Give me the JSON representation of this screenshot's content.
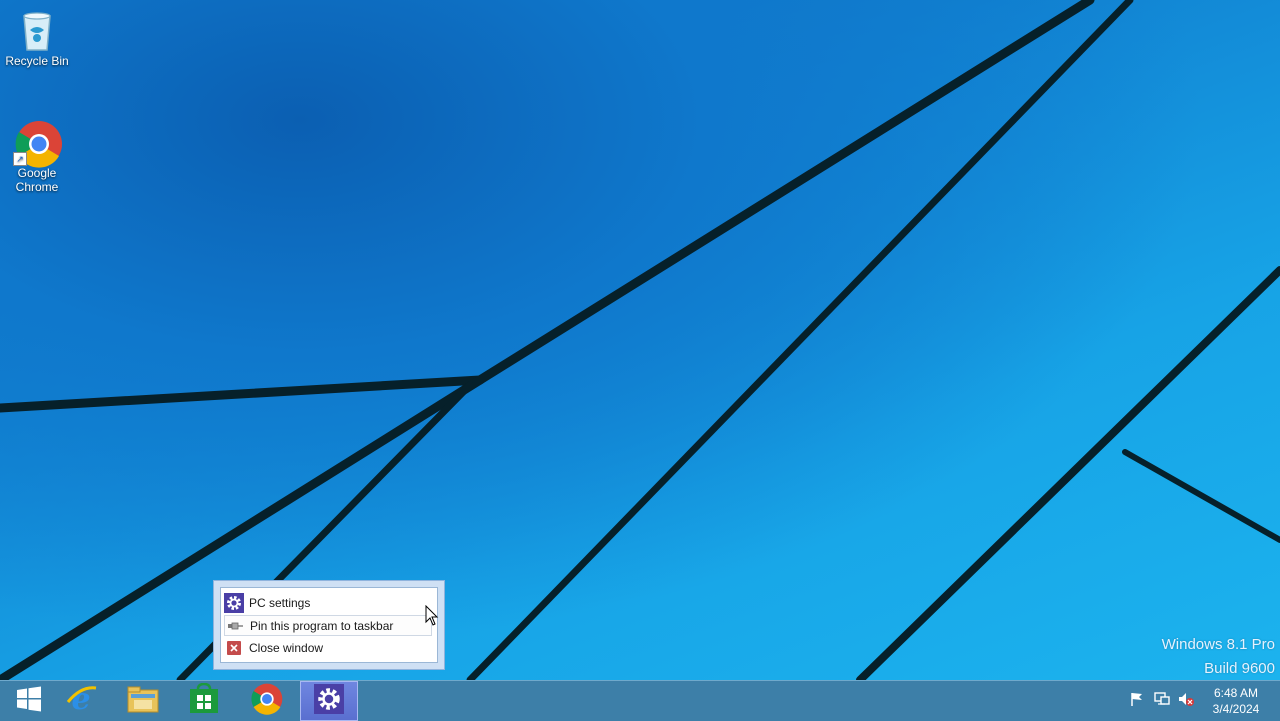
{
  "desktop": {
    "icons": [
      {
        "label": "Recycle Bin",
        "icon": "recycle-bin-icon"
      },
      {
        "label": "Google\nChrome",
        "icon": "chrome-icon"
      }
    ],
    "watermark": {
      "line1": "Windows 8.1 Pro",
      "line2": "Build 9600"
    }
  },
  "jumplist": {
    "items": [
      {
        "label": "PC settings",
        "icon": "gear-icon"
      },
      {
        "label": "Pin this program to taskbar",
        "icon": "pin-icon"
      },
      {
        "label": "Close window",
        "icon": "close-icon"
      }
    ]
  },
  "taskbar": {
    "buttons": [
      {
        "name": "start",
        "icon": "windows-logo-icon"
      },
      {
        "name": "internet-explorer",
        "icon": "ie-icon"
      },
      {
        "name": "file-explorer",
        "icon": "folder-icon"
      },
      {
        "name": "store",
        "icon": "store-icon"
      },
      {
        "name": "chrome",
        "icon": "chrome-icon"
      },
      {
        "name": "pc-settings",
        "icon": "gear-icon",
        "active": true
      }
    ],
    "tray_icons": [
      "flag-icon",
      "network-icon",
      "volume-muted-icon"
    ],
    "clock": {
      "time": "6:48 AM",
      "date": "3/4/2024"
    }
  },
  "colors": {
    "accent": "#5a6fd0",
    "wallpaper": "#1f9ad8",
    "settings_purple": "#4a3fa6"
  }
}
